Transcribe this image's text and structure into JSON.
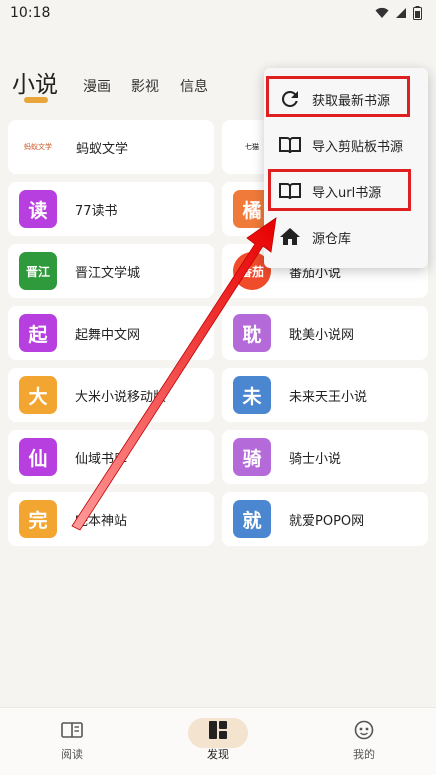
{
  "status_bar": {
    "time": "10:18"
  },
  "tabs": [
    {
      "label": "小说",
      "active": true
    },
    {
      "label": "漫画",
      "active": false
    },
    {
      "label": "影视",
      "active": false
    },
    {
      "label": "信息",
      "active": false
    }
  ],
  "sources": [
    {
      "name": "蚂蚁文学",
      "logo": "蚂蚁文学",
      "color": "#ffffff"
    },
    {
      "name": "",
      "logo": "七猫",
      "color": "#ffffff"
    },
    {
      "name": "77读书",
      "logo": "读",
      "color": "#b73fe0"
    },
    {
      "name": "",
      "logo": "橘",
      "color": "#f07a3a"
    },
    {
      "name": "晋江文学城",
      "logo": "晋江",
      "color": "#2f9a3c"
    },
    {
      "name": "番茄小说",
      "logo": "番茄",
      "color": "#f04b2a"
    },
    {
      "name": "起舞中文网",
      "logo": "起",
      "color": "#b73fe0"
    },
    {
      "name": "耽美小说网",
      "logo": "耽",
      "color": "#b46ad8"
    },
    {
      "name": "大米小说移动版",
      "logo": "大",
      "color": "#f3a532"
    },
    {
      "name": "未来天王小说",
      "logo": "未",
      "color": "#4b86d1"
    },
    {
      "name": "仙域书库",
      "logo": "仙",
      "color": "#b73fe0"
    },
    {
      "name": "骑士小说",
      "logo": "骑",
      "color": "#b46ad8"
    },
    {
      "name": "完本神站",
      "logo": "完",
      "color": "#f3a532"
    },
    {
      "name": "就爱POPO网",
      "logo": "就",
      "color": "#4b86d1"
    }
  ],
  "menu": {
    "items": [
      {
        "label": "获取最新书源",
        "icon": "refresh-icon",
        "highlighted": true
      },
      {
        "label": "导入剪贴板书源",
        "icon": "book-icon",
        "highlighted": false
      },
      {
        "label": "导入url书源",
        "icon": "book-icon",
        "highlighted": true
      },
      {
        "label": "源仓库",
        "icon": "home-icon",
        "highlighted": false
      }
    ]
  },
  "bottom_nav": [
    {
      "label": "阅读",
      "icon": "book-open-icon",
      "active": false
    },
    {
      "label": "发现",
      "icon": "dashboard-icon",
      "active": true
    },
    {
      "label": "我的",
      "icon": "face-icon",
      "active": false
    }
  ],
  "colors": {
    "accent": "#e8a63a",
    "highlight_box": "#e02020",
    "arrow": "#e02020",
    "background": "#f6f4f1"
  }
}
